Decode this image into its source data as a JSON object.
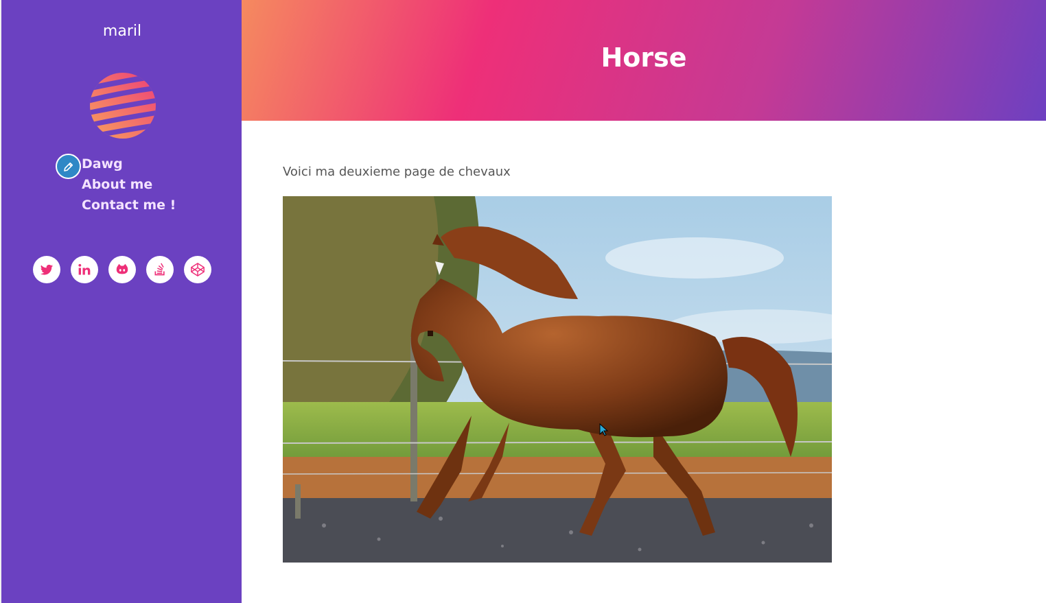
{
  "sidebar": {
    "site_title": "maril",
    "nav": [
      {
        "label": "Dawg"
      },
      {
        "label": "About me"
      },
      {
        "label": "Contact me !"
      }
    ],
    "social": [
      {
        "icon": "twitter-icon"
      },
      {
        "icon": "linkedin-icon"
      },
      {
        "icon": "github-icon"
      },
      {
        "icon": "stackoverflow-icon"
      },
      {
        "icon": "codepen-icon"
      }
    ]
  },
  "header": {
    "title": "Horse"
  },
  "main": {
    "intro": "Voici ma deuxieme page de chevaux",
    "image": {
      "subject": "chestnut horse galloping"
    }
  },
  "colors": {
    "sidebar": "#6b41c1",
    "accent": "#ee2f78",
    "nav_text": "#f4e3ff",
    "edit_badge": "#2f88c6"
  }
}
